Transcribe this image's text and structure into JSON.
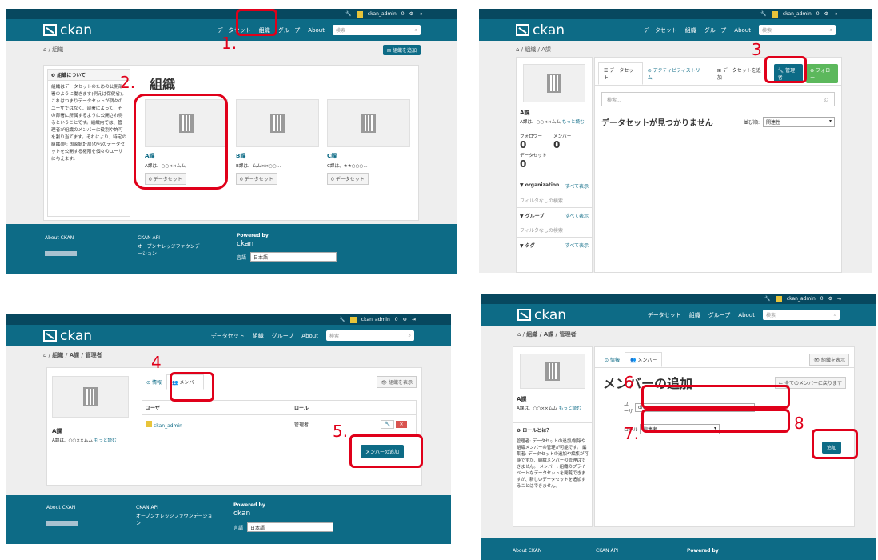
{
  "header": {
    "user": "ckan_admin",
    "count": "0",
    "brand": "ckan",
    "nav": [
      "データセット",
      "組織",
      "グループ",
      "About"
    ],
    "search_placeholder": "検索"
  },
  "p1": {
    "breadcrumb": "組織",
    "add_org": "組織を追加",
    "about_title": "組織について",
    "about_text": "組織はデータセットのための公開部署のように働きます(例えば保健省)。これはつまりデータセットが個々のユーザではなく、部署によって、その部署に所属するように公開され得るということです。組織内では、管理者が組織のメンバーに役割や許可を割り当てます。それにより、特定の組織(例: 国家統計局)からのデータセットを公開する権限を個々のユーザに与えます。",
    "heading": "組織",
    "orgs": [
      {
        "name": "A課",
        "desc": "A課は、○○××ムム",
        "count": "0 データセット"
      },
      {
        "name": "B課",
        "desc": "B課は、ムム××○○...",
        "count": "0 データセット"
      },
      {
        "name": "C課",
        "desc": "C課は、★★○○○...",
        "count": "0 データセット"
      }
    ]
  },
  "p2": {
    "breadcrumb": "組織 / A課",
    "org_name": "A課",
    "org_desc": "A課は、○○××ムム",
    "more": "もっと読む",
    "followers_label": "フォロワー",
    "followers": "0",
    "members_label": "メンバー",
    "members": "0",
    "datasets_label": "データセット",
    "datasets": "0",
    "tabs": [
      "データセット",
      "アクティビティストリーム",
      "データセットを追加"
    ],
    "manage": "管理者",
    "follow": "フォロー",
    "search_placeholder": "検索...",
    "empty": "データセットが見つかりません",
    "sort_label": "並び順:",
    "sort_value": "関連性",
    "facets": [
      {
        "title": "organization",
        "all": "すべて表示",
        "empty": "フィルタなしの検索"
      },
      {
        "title": "グループ",
        "all": "すべて表示",
        "empty": "フィルタなしの検索"
      },
      {
        "title": "タグ",
        "all": "すべて表示",
        "empty": ""
      }
    ]
  },
  "p3": {
    "breadcrumb": "組織 / A課 / 管理者",
    "tab_info": "情報",
    "tab_members": "メンバー",
    "view_org": "組織を表示",
    "col_user": "ユーザ",
    "col_role": "ロール",
    "member_user": "ckan_admin",
    "member_role": "管理者",
    "add_member": "メンバーの追加"
  },
  "p4": {
    "breadcrumb": "組織 / A課 / 管理者",
    "heading": "メンバーの追加",
    "back": "全てのメンバーに戻ります",
    "user_label": "ユーザ",
    "user_value": "div_a",
    "role_label": "ロール",
    "role_value": "編集者",
    "submit": "追加",
    "role_help_title": "ロールとは？",
    "role_help": "管理者: データセットの追加/削除や組織メンバーの管理が可能です。 編集者: データセットの追加や編集が可能ですが、組織メンバーの管理はできません。 メンバー: 組織のプライベートなデータセットを閲覧できますが、新しいデータセットを追加することはできません。"
  },
  "footer": {
    "about": "About CKAN",
    "api": "CKAN API",
    "okfn": "オープンナレッジファウンデーション",
    "powered": "Powered by",
    "lang_label": "言語",
    "lang": "日本語"
  },
  "steps": [
    "1.",
    "2.",
    "3",
    "4",
    "5.",
    "6",
    "7.",
    "8"
  ],
  "colors": {
    "header_dark": "#07485f",
    "masthead": "#0d6b86",
    "highlight": "#e0001a"
  }
}
